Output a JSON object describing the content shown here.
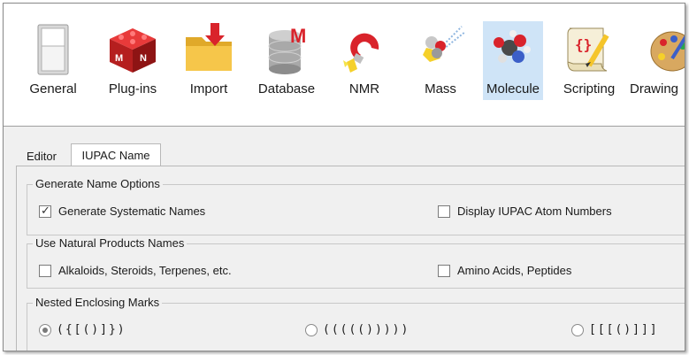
{
  "toolbar": {
    "items": [
      {
        "label": "General",
        "icon": "switch-icon"
      },
      {
        "label": "Plug-ins",
        "icon": "red-cube-icon"
      },
      {
        "label": "Import",
        "icon": "folder-import-icon"
      },
      {
        "label": "Database",
        "icon": "database-icon"
      },
      {
        "label": "NMR",
        "icon": "magnet-icon"
      },
      {
        "label": "Mass",
        "icon": "mass-spec-icon"
      },
      {
        "label": "Molecule",
        "icon": "molecule-icon",
        "selected": true
      },
      {
        "label": "Scripting",
        "icon": "script-scroll-icon"
      },
      {
        "label": "Drawing",
        "icon": "palette-icon"
      }
    ],
    "selected_color": "#cfe4f7"
  },
  "tabs": [
    {
      "label": "Editor",
      "active": false
    },
    {
      "label": "IUPAC Name",
      "active": true
    }
  ],
  "groups": {
    "generate": {
      "title": "Generate Name Options",
      "systematic": {
        "label": "Generate Systematic Names",
        "checked": true
      },
      "atom_numbers": {
        "label": "Display IUPAC Atom Numbers",
        "checked": false
      }
    },
    "natural": {
      "title": "Use Natural Products Names",
      "alkaloids": {
        "label": "Alkaloids, Steroids, Terpenes, etc.",
        "checked": false
      },
      "amino": {
        "label": "Amino Acids, Peptides",
        "checked": false
      }
    },
    "nested": {
      "title": "Nested Enclosing Marks",
      "options": [
        {
          "label": "({[()]})",
          "selected": true
        },
        {
          "label": "((((()))))",
          "selected": false
        },
        {
          "label": "[[[()]]]",
          "selected": false
        }
      ]
    }
  }
}
